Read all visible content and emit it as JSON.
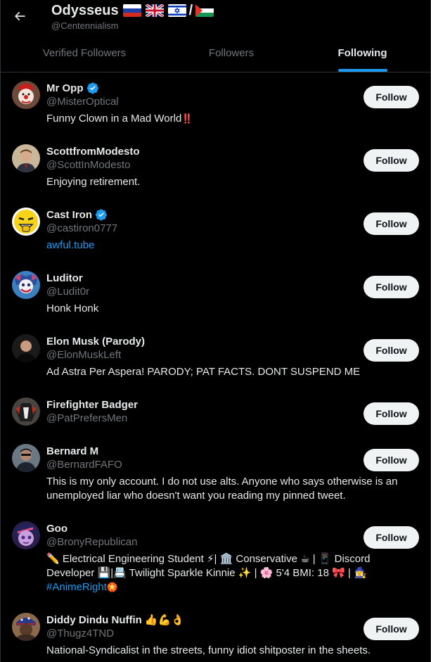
{
  "header": {
    "title": "Odysseus",
    "handle": "@Centennialism",
    "flags": [
      "russia-flag",
      "uk-flag",
      "israel-flag",
      "palestine-flag"
    ],
    "separator": "/"
  },
  "tabs": [
    {
      "label": "Verified Followers",
      "active": false
    },
    {
      "label": "Followers",
      "active": false
    },
    {
      "label": "Following",
      "active": true
    }
  ],
  "users": [
    {
      "name": "Mr Opp",
      "handle": "@MisterOptical",
      "verified": true,
      "bio": "Funny Clown in a Mad World",
      "bio_emoji": "‼️",
      "follow_label": "Follow"
    },
    {
      "name": "ScottfromModesto",
      "handle": "@ScottInModesto",
      "verified": false,
      "bio": "Enjoying retirement.",
      "follow_label": "Follow"
    },
    {
      "name": "Cast Iron",
      "handle": "@castiron0777",
      "verified": true,
      "bio_link": "awful.tube",
      "follow_label": "Follow"
    },
    {
      "name": "Luditor",
      "handle": "@Ludit0r",
      "verified": false,
      "bio": "Honk Honk",
      "follow_label": "Follow"
    },
    {
      "name": "Elon Musk (Parody)",
      "handle": "@ElonMuskLeft",
      "verified": false,
      "bio": "Ad Astra Per Aspera! PARODY; PAT FACTS. DONT SUSPEND ME",
      "follow_label": "Follow"
    },
    {
      "name": "Firefighter Badger",
      "handle": "@PatPrefersMen",
      "verified": false,
      "bio": "",
      "follow_label": "Follow"
    },
    {
      "name": "Bernard M",
      "handle": "@BernardFAFO",
      "verified": false,
      "bio": "This is my only account. I do not use alts. Anyone who says otherwise is an unemployed liar who doesn't want you reading my pinned tweet.",
      "follow_label": "Follow"
    },
    {
      "name": "Goo",
      "handle": "@BronyRepublican",
      "verified": false,
      "bio": "✏️ Electrical Engineering Student ⚡| 🏛️ Conservative ☕ | 📱 Discord Developer 💾|📇 Twilight Sparkle Kinnie ✨ | 🌸 5'4 BMI: 18 🎀 | 🧙‍♀️",
      "bio_link": "#AnimeRight",
      "bio_link_emoji": "🏵️",
      "follow_label": "Follow"
    },
    {
      "name": "Diddy Dindu Nuffin",
      "name_emoji": "👍💪👌",
      "handle": "@Thugz4TND",
      "verified": false,
      "bio": "National-Syndicalist in the streets, funny idiot shitposter in the sheets.",
      "follow_label": "Follow"
    }
  ],
  "colors": {
    "accent": "#1d9bf0",
    "background": "#000000",
    "muted": "#71767b",
    "text": "#e7e9ea"
  }
}
